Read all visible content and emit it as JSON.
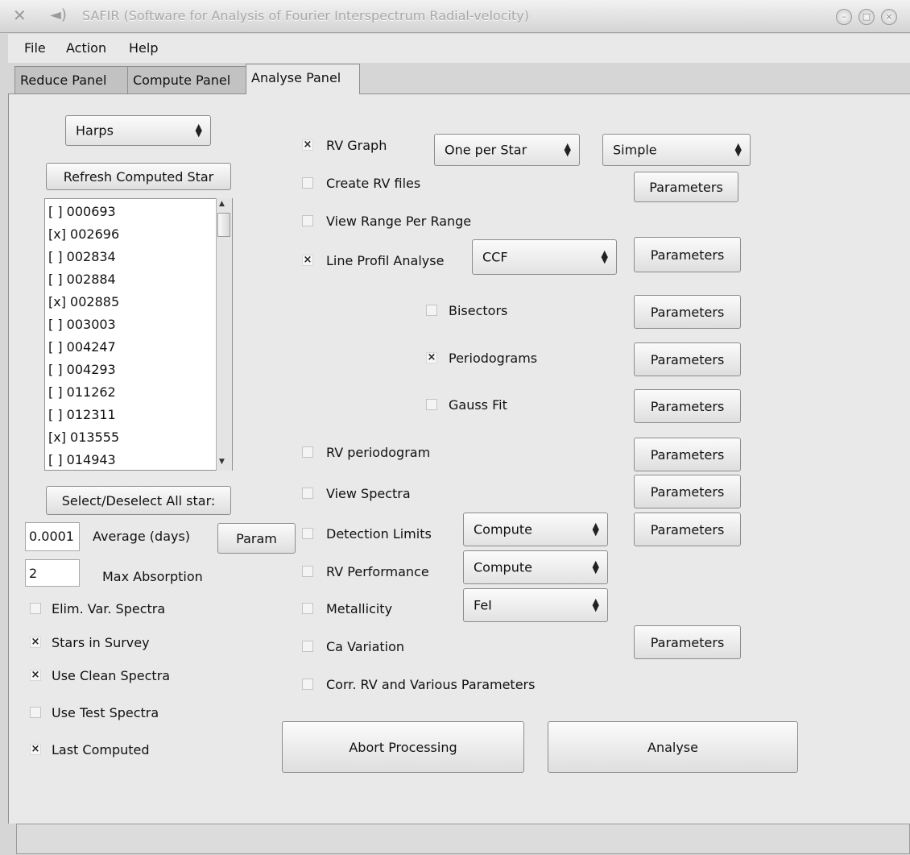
{
  "window": {
    "title": "SAFIR (Software for Analysis of Fourier Interspectrum Radial-velocity)",
    "tabs": [
      "Reduce Panel",
      "Compute Panel",
      "Analyse Panel"
    ],
    "active_tab": "Analyse Panel"
  },
  "menu": [
    "File",
    "Action",
    "Help"
  ],
  "left": {
    "instrument": "Harps",
    "refresh_button": "Refresh Computed Star",
    "stars": [
      "[ ] 000693",
      "[x] 002696",
      "[ ] 002834",
      "[ ] 002884",
      "[x] 002885",
      "[ ] 003003",
      "[ ] 004247",
      "[ ] 004293",
      "[ ] 011262",
      "[ ] 012311",
      "[x] 013555",
      "[ ] 014943"
    ],
    "select_all_button": "Select/Deselect All star:",
    "average_value": "0.0001",
    "average_label": "Average (days)",
    "param_button": "Param",
    "max_absorption_value": "2",
    "max_absorption_label": "Max Absorption",
    "options": [
      {
        "label": "Elim. Var. Spectra",
        "checked": false
      },
      {
        "label": "Stars in Survey",
        "checked": true
      },
      {
        "label": "Use Clean Spectra",
        "checked": true
      },
      {
        "label": "Use Test Spectra",
        "checked": false
      },
      {
        "label": "Last Computed",
        "checked": true
      }
    ]
  },
  "right": {
    "rv_graph": {
      "label": "RV Graph",
      "checked": true,
      "mode": "One per Star",
      "style": "Simple"
    },
    "create_rv_files": {
      "label": "Create RV files",
      "checked": false
    },
    "view_range": {
      "label": "View Range Per Range",
      "checked": false
    },
    "line_profil": {
      "label": "Line Profil Analyse",
      "checked": true,
      "method": "CCF"
    },
    "bisectors": {
      "label": "Bisectors",
      "checked": false
    },
    "periodograms": {
      "label": "Periodograms",
      "checked": true
    },
    "gauss_fit": {
      "label": "Gauss Fit",
      "checked": false
    },
    "rv_periodogram": {
      "label": "RV periodogram",
      "checked": false
    },
    "view_spectra": {
      "label": "View Spectra",
      "checked": false
    },
    "detection_limits": {
      "label": "Detection Limits",
      "checked": false,
      "mode": "Compute"
    },
    "rv_performance": {
      "label": "RV Performance",
      "checked": false,
      "mode": "Compute"
    },
    "metallicity": {
      "label": "Metallicity",
      "checked": false,
      "element": "FeI"
    },
    "ca_variation": {
      "label": "Ca Variation",
      "checked": false
    },
    "corr_rv": {
      "label": "Corr. RV and Various Parameters",
      "checked": false
    },
    "parameters_label": "Parameters",
    "abort_button": "Abort Processing",
    "analyse_button": "Analyse"
  },
  "check_glyph": "×",
  "combo_arrow_up": "▲",
  "combo_arrow_down": "▼"
}
